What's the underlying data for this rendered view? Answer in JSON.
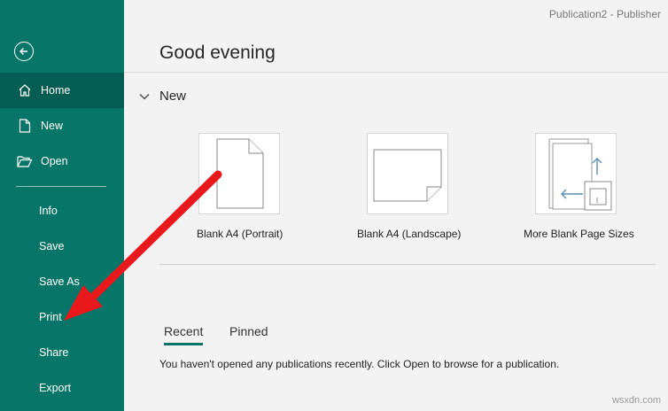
{
  "window": {
    "title": "Publication2  -  Publisher"
  },
  "sidebar": {
    "back_label": "Back",
    "items": [
      {
        "label": "Home",
        "icon": "home-icon",
        "active": true
      },
      {
        "label": "New",
        "icon": "new-document-icon"
      },
      {
        "label": "Open",
        "icon": "folder-open-icon"
      },
      {
        "label": "Info"
      },
      {
        "label": "Save"
      },
      {
        "label": "Save As"
      },
      {
        "label": "Print"
      },
      {
        "label": "Share"
      },
      {
        "label": "Export"
      }
    ]
  },
  "main": {
    "greeting": "Good evening",
    "new_section": {
      "label": "New",
      "icon": "chevron-down-icon"
    },
    "templates": [
      {
        "label": "Blank A4 (Portrait)"
      },
      {
        "label": "Blank A4 (Landscape)"
      },
      {
        "label": "More Blank Page Sizes"
      }
    ],
    "tabs": [
      {
        "label": "Recent",
        "active": true
      },
      {
        "label": "Pinned"
      }
    ],
    "empty_message": "You haven't opened any publications recently. Click Open to browse for a publication."
  },
  "watermark": "wsxdn.com",
  "annotation": {
    "color": "#e8181c"
  },
  "colors": {
    "sidebar": "#077568",
    "sidebar_active": "#055d53"
  }
}
